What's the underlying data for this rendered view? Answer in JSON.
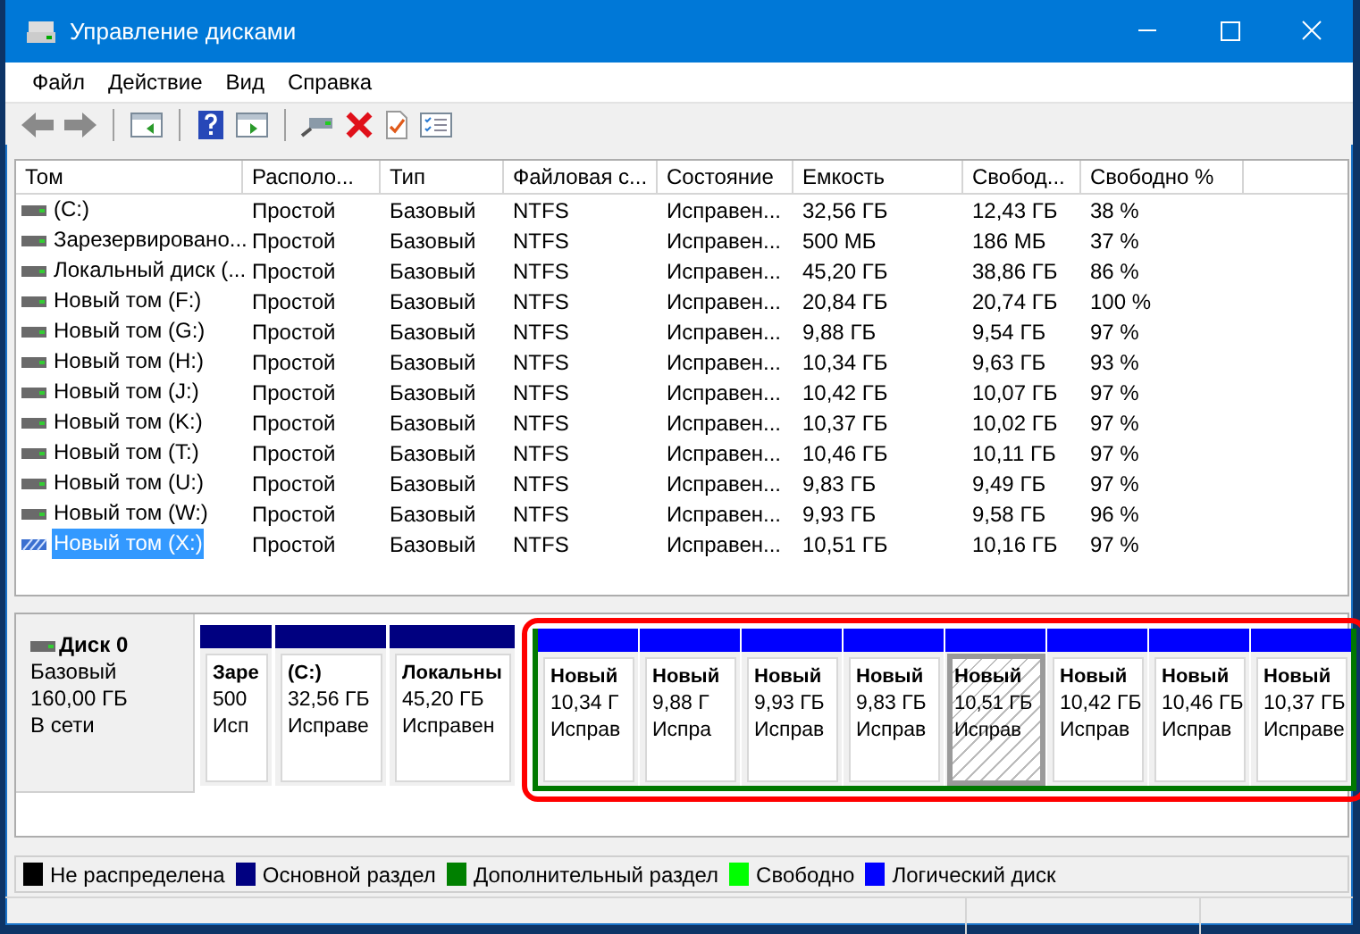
{
  "window": {
    "title": "Управление дисками"
  },
  "menu": [
    "Файл",
    "Действие",
    "Вид",
    "Справка"
  ],
  "toolbar": [
    {
      "kind": "back"
    },
    {
      "kind": "forward"
    },
    {
      "kind": "sep"
    },
    {
      "kind": "panel-left"
    },
    {
      "kind": "sep"
    },
    {
      "kind": "help"
    },
    {
      "kind": "panel-right"
    },
    {
      "kind": "sep"
    },
    {
      "kind": "connect"
    },
    {
      "kind": "delete"
    },
    {
      "kind": "check"
    },
    {
      "kind": "list"
    }
  ],
  "table": {
    "columns": [
      "Том",
      "Располо...",
      "Тип",
      "Файловая с...",
      "Состояние",
      "Емкость",
      "Свобод...",
      "Свободно %"
    ],
    "rows": [
      {
        "selected": false,
        "cells": [
          " (C:)",
          "Простой",
          "Базовый",
          "NTFS",
          "Исправен...",
          "32,56 ГБ",
          "12,43 ГБ",
          "38 %"
        ]
      },
      {
        "selected": false,
        "cells": [
          "Зарезервировано...",
          "Простой",
          "Базовый",
          "NTFS",
          "Исправен...",
          "500 МБ",
          "186 МБ",
          "37 %"
        ]
      },
      {
        "selected": false,
        "cells": [
          "Локальный диск (...",
          "Простой",
          "Базовый",
          "NTFS",
          "Исправен...",
          "45,20 ГБ",
          "38,86 ГБ",
          "86 %"
        ]
      },
      {
        "selected": false,
        "cells": [
          "Новый том (F:)",
          "Простой",
          "Базовый",
          "NTFS",
          "Исправен...",
          "20,84 ГБ",
          "20,74 ГБ",
          "100 %"
        ]
      },
      {
        "selected": false,
        "cells": [
          "Новый том (G:)",
          "Простой",
          "Базовый",
          "NTFS",
          "Исправен...",
          "9,88 ГБ",
          "9,54 ГБ",
          "97 %"
        ]
      },
      {
        "selected": false,
        "cells": [
          "Новый том (H:)",
          "Простой",
          "Базовый",
          "NTFS",
          "Исправен...",
          "10,34 ГБ",
          "9,63 ГБ",
          "93 %"
        ]
      },
      {
        "selected": false,
        "cells": [
          "Новый том (J:)",
          "Простой",
          "Базовый",
          "NTFS",
          "Исправен...",
          "10,42 ГБ",
          "10,07 ГБ",
          "97 %"
        ]
      },
      {
        "selected": false,
        "cells": [
          "Новый том (K:)",
          "Простой",
          "Базовый",
          "NTFS",
          "Исправен...",
          "10,37 ГБ",
          "10,02 ГБ",
          "97 %"
        ]
      },
      {
        "selected": false,
        "cells": [
          "Новый том (T:)",
          "Простой",
          "Базовый",
          "NTFS",
          "Исправен...",
          "10,46 ГБ",
          "10,11 ГБ",
          "97 %"
        ]
      },
      {
        "selected": false,
        "cells": [
          "Новый том (U:)",
          "Простой",
          "Базовый",
          "NTFS",
          "Исправен...",
          "9,83 ГБ",
          "9,49 ГБ",
          "97 %"
        ]
      },
      {
        "selected": false,
        "cells": [
          "Новый том (W:)",
          "Простой",
          "Базовый",
          "NTFS",
          "Исправен...",
          "9,93 ГБ",
          "9,58 ГБ",
          "96 %"
        ]
      },
      {
        "selected": true,
        "cells": [
          "Новый том (X:)",
          "Простой",
          "Базовый",
          "NTFS",
          "Исправен...",
          "10,51 ГБ",
          "10,16 ГБ",
          "97 %"
        ]
      }
    ]
  },
  "disk": {
    "name": "Диск 0",
    "type": "Базовый",
    "size": "160,00 ГБ",
    "status": "В сети",
    "partitions": [
      {
        "kind": "primary",
        "selected": false,
        "name": "Заре",
        "size": "500",
        "status": "Исп"
      },
      {
        "kind": "primary",
        "selected": false,
        "name": "(C:)",
        "size": "32,56 ГБ",
        "status": "Исправе"
      },
      {
        "kind": "primary",
        "selected": false,
        "name": "Локальны",
        "size": "45,20 ГБ",
        "status": "Исправен"
      }
    ],
    "extended": {
      "highlighted": true,
      "partitions": [
        {
          "kind": "logical",
          "selected": false,
          "name": "Новый",
          "size": "10,34 Г",
          "status": "Исправ"
        },
        {
          "kind": "logical",
          "selected": false,
          "name": "Новый",
          "size": "9,88 Г",
          "status": "Испра"
        },
        {
          "kind": "logical",
          "selected": false,
          "name": "Новый",
          "size": "9,93 ГБ",
          "status": "Исправ"
        },
        {
          "kind": "logical",
          "selected": false,
          "name": "Новый",
          "size": "9,83 ГБ",
          "status": "Исправ"
        },
        {
          "kind": "logical",
          "selected": true,
          "name": "Новый",
          "size": "10,51 ГБ",
          "status": "Исправ"
        },
        {
          "kind": "logical",
          "selected": false,
          "name": "Новый",
          "size": "10,42 ГБ",
          "status": "Исправ"
        },
        {
          "kind": "logical",
          "selected": false,
          "name": "Новый",
          "size": "10,46 ГБ",
          "status": "Исправ"
        },
        {
          "kind": "logical",
          "selected": false,
          "name": "Новый",
          "size": "10,37 ГБ",
          "status": "Исправе"
        }
      ]
    }
  },
  "legend": [
    {
      "label": "Не распределена",
      "color": "#000000"
    },
    {
      "label": "Основной раздел",
      "color": "#000080"
    },
    {
      "label": "Дополнительный раздел",
      "color": "#008000"
    },
    {
      "label": "Свободно",
      "color": "#00ff00"
    },
    {
      "label": "Логический диск",
      "color": "#0000ff"
    }
  ]
}
